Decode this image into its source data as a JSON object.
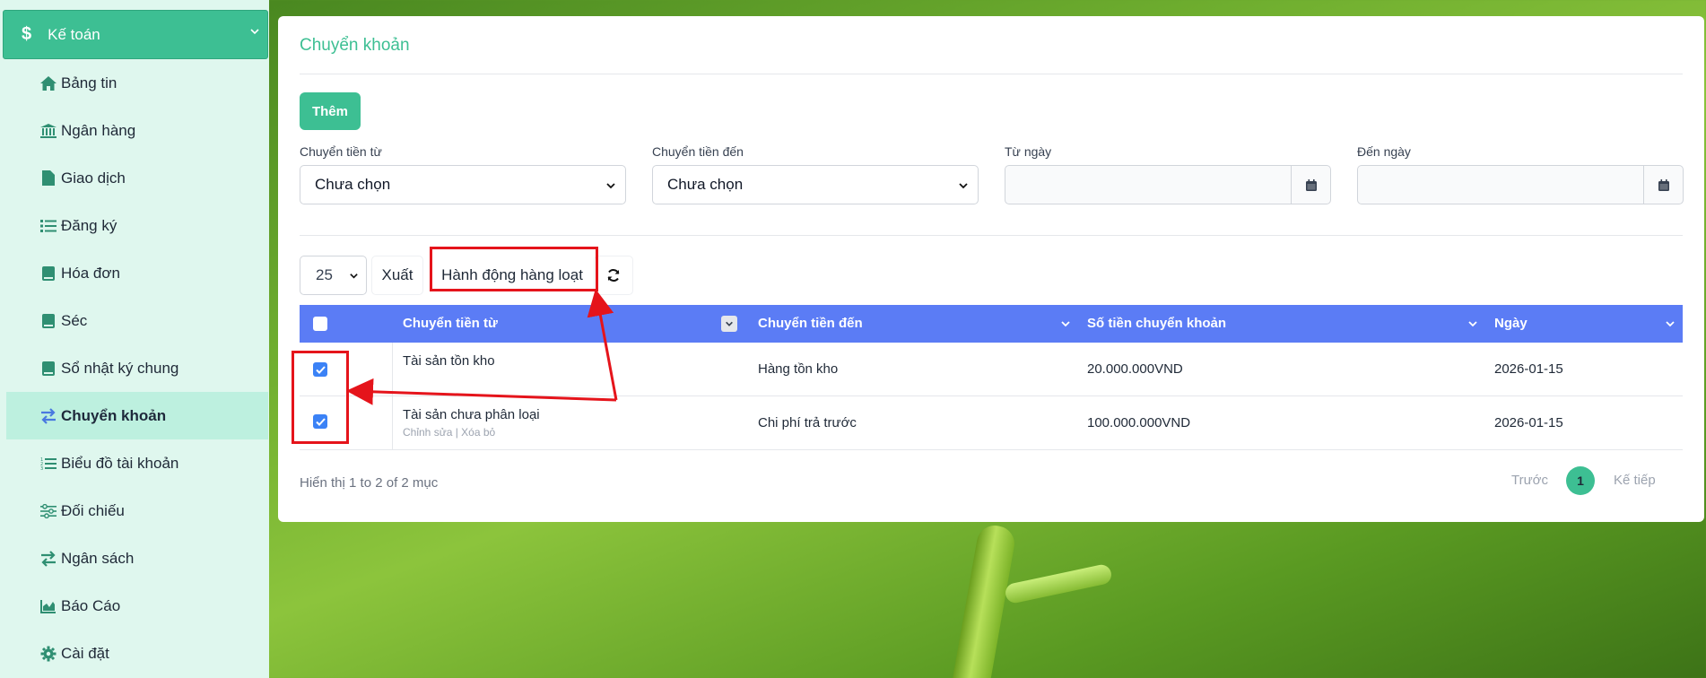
{
  "sidebar": {
    "header": {
      "icon": "dollar-icon",
      "label": "Kế toán"
    },
    "items": [
      {
        "icon": "home-icon",
        "label": "Bảng tin"
      },
      {
        "icon": "bank-icon",
        "label": "Ngân hàng"
      },
      {
        "icon": "file-icon",
        "label": "Giao dịch"
      },
      {
        "icon": "list-icon",
        "label": "Đăng ký"
      },
      {
        "icon": "book-icon",
        "label": "Hóa đơn"
      },
      {
        "icon": "book-icon",
        "label": "Séc"
      },
      {
        "icon": "book-icon",
        "label": "Sổ nhật ký chung"
      },
      {
        "icon": "transfer-icon",
        "label": "Chuyển khoản",
        "active": true
      },
      {
        "icon": "ordered-list-icon",
        "label": "Biểu đồ tài khoản"
      },
      {
        "icon": "sliders-icon",
        "label": "Đối chiếu"
      },
      {
        "icon": "transfer-icon",
        "label": "Ngân sách"
      },
      {
        "icon": "chart-area-icon",
        "label": "Báo Cáo"
      },
      {
        "icon": "gear-icon",
        "label": "Cài đặt"
      }
    ]
  },
  "main": {
    "title": "Chuyển khoản",
    "add_button": "Thêm",
    "filters": {
      "from_label": "Chuyển tiền từ",
      "from_value": "Chưa chọn",
      "to_label": "Chuyển tiền đến",
      "to_value": "Chưa chọn",
      "date_from_label": "Từ ngày",
      "date_to_label": "Đến ngày"
    },
    "toolbar": {
      "page_size": "25",
      "export_label": "Xuất",
      "bulk_label": "Hành động hàng loạt"
    },
    "table": {
      "headers": [
        "Chuyển tiền từ",
        "Chuyển tiền đến",
        "Số tiền chuyển khoản",
        "Ngày"
      ],
      "rows": [
        {
          "from": "Tài sản tồn kho",
          "to": "Hàng tồn kho",
          "amount": "20.000.000VND",
          "date": "2026-01-15",
          "checked": true
        },
        {
          "from": "Tài sản chưa phân loại",
          "to": "Chi phí trả trước",
          "amount": "100.000.000VND",
          "date": "2026-01-15",
          "checked": true,
          "actions": "Chỉnh sửa | Xóa bỏ"
        }
      ]
    },
    "footer": {
      "info": "Hiển thị 1 to 2 of 2 mục",
      "prev": "Trước",
      "page": "1",
      "next": "Kế tiếp"
    }
  },
  "colors": {
    "accent": "#3dbf93",
    "table_header": "#5b7cf5",
    "annotation": "#e5141b"
  }
}
